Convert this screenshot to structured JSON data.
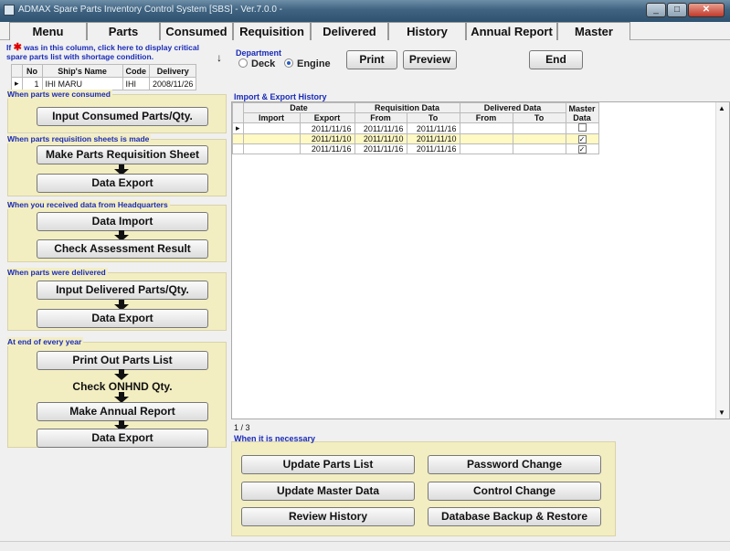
{
  "window": {
    "title": "ADMAX Spare Parts Inventory Control System [SBS] - Ver.7.0.0 -"
  },
  "tabs": [
    "Menu",
    "Parts",
    "Consumed",
    "Requisition",
    "Delivered",
    "History",
    "Annual Report",
    "Master"
  ],
  "critical": {
    "note_prefix": "If",
    "note_star": "✱",
    "note_text": "was in this column, click here to display critical spare parts list with shortage condition."
  },
  "ship_table": {
    "headers": [
      "No",
      "Ship's Name",
      "Code",
      "Delivery"
    ],
    "rows": [
      {
        "no": "1",
        "name": "IHI MARU",
        "code": "IHI",
        "delivery": "2008/11/26"
      }
    ]
  },
  "sections": {
    "consumed": {
      "label": "When parts were consumed",
      "button": "Input Consumed Parts/Qty."
    },
    "requisition": {
      "label": "When parts requisition sheets is made",
      "button1": "Make Parts Requisition Sheet",
      "button2": "Data Export"
    },
    "headquarters": {
      "label": "When you received data from Headquarters",
      "button1": "Data Import",
      "button2": "Check Assessment Result"
    },
    "delivered": {
      "label": "When parts were delivered",
      "button1": "Input Delivered Parts/Qty.",
      "button2": "Data Export"
    },
    "year_end": {
      "label": "At end of every year",
      "button1": "Print Out Parts List",
      "text": "Check ONHND Qty.",
      "button2": "Make Annual Report",
      "button3": "Data Export"
    }
  },
  "department": {
    "label": "Department",
    "options": [
      "Deck",
      "Engine"
    ],
    "selected": "Engine"
  },
  "toolbar": {
    "print": "Print",
    "preview": "Preview",
    "end": "End"
  },
  "history": {
    "label": "Import & Export History",
    "group_headers": [
      "Date",
      "Requisition Data",
      "Delivered Data",
      "Master Data"
    ],
    "sub_headers": [
      "Import",
      "Export",
      "From",
      "To",
      "From",
      "To"
    ],
    "rows": [
      {
        "import": "",
        "export": "2011/11/16",
        "req_from": "2011/11/16",
        "req_to": "2011/11/16",
        "del_from": "",
        "del_to": "",
        "master": false
      },
      {
        "import": "",
        "export": "2011/11/10",
        "req_from": "2011/11/10",
        "req_to": "2011/11/10",
        "del_from": "",
        "del_to": "",
        "master": true
      },
      {
        "import": "",
        "export": "2011/11/16",
        "req_from": "2011/11/16",
        "req_to": "2011/11/16",
        "del_from": "",
        "del_to": "",
        "master": true
      }
    ],
    "page": "1 / 3"
  },
  "necessary": {
    "label": "When it is necessary",
    "buttons": [
      "Update Parts List",
      "Password Change",
      "Update Master Data",
      "Control Change",
      "Review History",
      "Database Backup & Restore"
    ]
  },
  "colors": {
    "panel": "#f3eec2",
    "label_blue": "#1a2bb8",
    "selected_row": "#fff9c4"
  }
}
